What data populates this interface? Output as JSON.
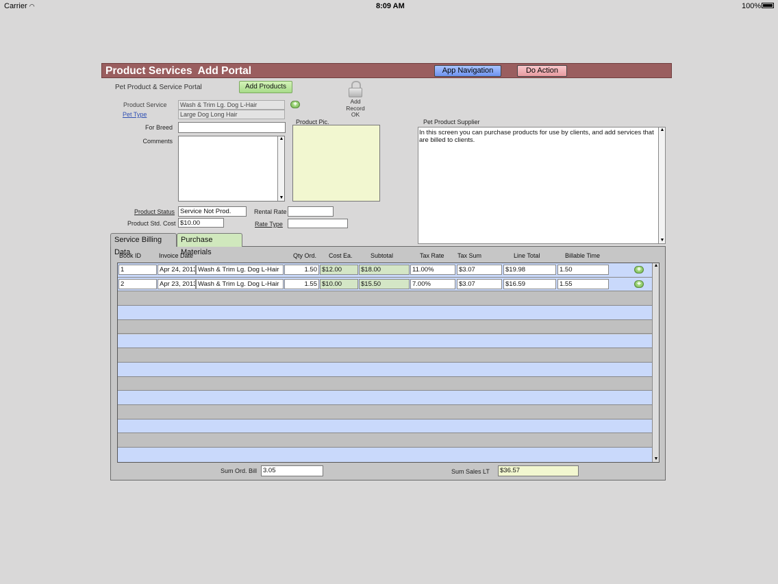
{
  "status_bar": {
    "carrier": "Carrier",
    "time": "8:09 AM",
    "battery": "100%"
  },
  "header": {
    "title": "Product Services  Add Portal",
    "app_nav_label": "App Navigation",
    "do_action_label": "Do Action"
  },
  "form": {
    "portal_label": "Pet Product & Service Portal",
    "add_products_label": "Add Products",
    "add_record": {
      "line1": "Add",
      "line2": "Record",
      "line3": "OK"
    },
    "product_service_label": "Product  Service",
    "product_service_value": "Wash & Trim Lg. Dog L-Hair",
    "pet_type_label": "Pet Type",
    "pet_type_value": "Large Dog Long Hair",
    "for_breed_label": "For Breed",
    "for_breed_value": "",
    "comments_label": "Comments",
    "product_pic_label": "Product Pic.",
    "supplier_label": "Pet Product Supplier",
    "supplier_text": " In this screen you can purchase products for use by clients, and add services that are billed to clients.",
    "product_status_label": "Product Status",
    "product_status_value": "Service Not Prod.",
    "rental_rate_label": "Rental Rate",
    "rental_rate_value": "",
    "std_cost_label": "Product Std. Cost",
    "std_cost_value": "$10.00",
    "rate_type_label": "Rate Type",
    "rate_type_value": ""
  },
  "tabs": {
    "service_billing": "Service Billing Data",
    "purchase_materials": "Purchase Materials"
  },
  "portal": {
    "columns": {
      "book_id": "Book ID",
      "invoice_date": "Invoice Date",
      "qty_ord": "Qty Ord.",
      "cost_ea": "Cost Ea.",
      "subtotal": "Subtotal",
      "tax_rate": "Tax Rate",
      "tax_sum": "Tax Sum",
      "line_total": "Line Total",
      "billable_time": "Billable Time"
    },
    "rows": [
      {
        "book_id": "1",
        "invoice_date": "Apr 24, 2013",
        "service": "Wash & Trim Lg. Dog L-Hair",
        "qty": "1.50",
        "cost": "$12.00",
        "subtotal": "$18.00",
        "tax_rate": "11.00%",
        "tax_sum": "$3.07",
        "line_total": "$19.98",
        "billable_time": "1.50"
      },
      {
        "book_id": "2",
        "invoice_date": "Apr 23, 2013",
        "service": "Wash & Trim Lg. Dog L-Hair",
        "qty": "1.55",
        "cost": "$10.00",
        "subtotal": "$15.50",
        "tax_rate": "7.00%",
        "tax_sum": "$3.07",
        "line_total": "$16.59",
        "billable_time": "1.55"
      }
    ]
  },
  "summary": {
    "sum_ord_bill_label": "Sum Ord. Bill",
    "sum_ord_bill_value": "3.05",
    "sum_sales_lt_label": "Sum Sales LT",
    "sum_sales_lt_value": "$36.57"
  },
  "colors": {
    "title_bar": "#9a5e5f",
    "app_nav_button": "#7e9ff2",
    "do_action_button": "#eeb0b5",
    "add_products_button": "#b9e59a",
    "product_pic_bg": "#f2f7d0",
    "portal_row_blue": "#c9d9fb"
  }
}
